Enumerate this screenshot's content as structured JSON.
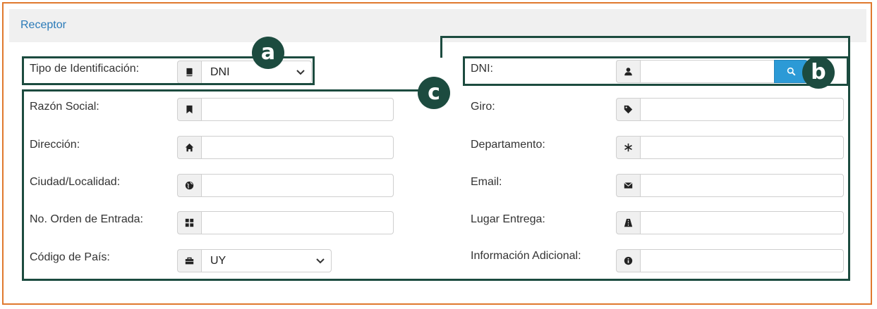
{
  "panel": {
    "title": "Receptor"
  },
  "fields": {
    "tipo": {
      "label": "Tipo de Identificación:",
      "value": "DNI",
      "icon": "book-icon"
    },
    "dni": {
      "label": "DNI:",
      "value": "",
      "icon": "user-icon",
      "button_icon": "search-icon"
    },
    "razon": {
      "label": "Razón Social:",
      "value": "",
      "icon": "bookmark-icon"
    },
    "giro": {
      "label": "Giro:",
      "value": "",
      "icon": "tag-icon"
    },
    "direccion": {
      "label": "Dirección:",
      "value": "",
      "icon": "home-icon"
    },
    "departamento": {
      "label": "Departamento:",
      "value": "",
      "icon": "asterisk-icon"
    },
    "ciudad": {
      "label": "Ciudad/Localidad:",
      "value": "",
      "icon": "globe-icon"
    },
    "email": {
      "label": "Email:",
      "value": "",
      "icon": "envelope-icon"
    },
    "orden": {
      "label": "No. Orden de Entrada:",
      "value": "",
      "icon": "grid-icon"
    },
    "lugar": {
      "label": "Lugar Entrega:",
      "value": "",
      "icon": "road-icon"
    },
    "pais": {
      "label": "Código de País:",
      "value": "UY",
      "icon": "briefcase-icon"
    },
    "info": {
      "label": "Información Adicional:",
      "value": "",
      "icon": "info-icon"
    }
  },
  "annotations": {
    "a": "a",
    "b": "b",
    "c": "c"
  },
  "colors": {
    "frame": "#e0792e",
    "annotation": "#1c4b3f",
    "link": "#2a7ab8",
    "button": "#2c9ad6"
  }
}
